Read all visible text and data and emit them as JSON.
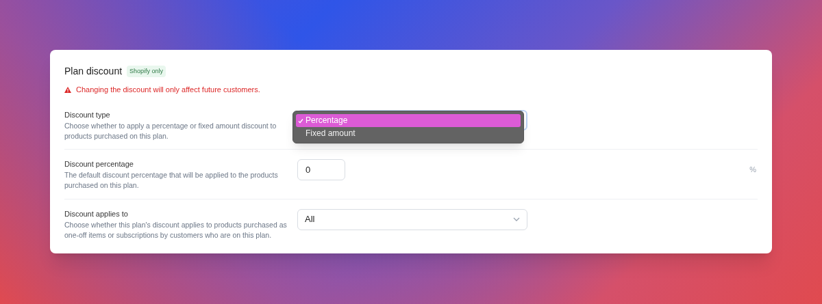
{
  "card": {
    "title": "Plan discount",
    "badge": "Shopify only",
    "warning": "Changing the discount will only affect future customers."
  },
  "fields": [
    {
      "kind": "menu",
      "label": "Discount type",
      "description": "Choose whether to apply a percentage or fixed amount discount to products purchased on this plan.",
      "options": [
        {
          "label": "Percentage",
          "selected": true
        },
        {
          "label": "Fixed amount",
          "selected": false
        }
      ]
    },
    {
      "kind": "number",
      "label": "Discount percentage",
      "description": "The default discount percentage that will be applied to the products purchased on this plan.",
      "value": "0",
      "suffix": "%"
    },
    {
      "kind": "select",
      "label": "Discount applies to",
      "description": "Choose whether this plan's discount applies to products purchased as one-off items or subscriptions by customers who are on this plan.",
      "value": "All"
    }
  ]
}
